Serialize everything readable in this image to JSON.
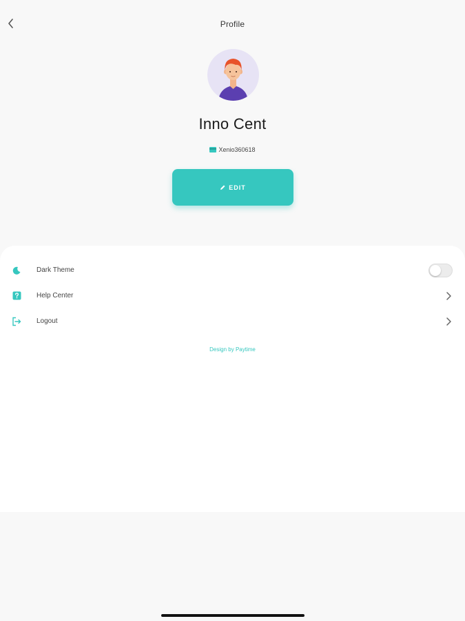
{
  "header": {
    "title": "Profile",
    "back_icon": "chevron-left-icon"
  },
  "profile": {
    "name": "Inno Cent",
    "user_id": "Xenio360618",
    "edit_label": "EDIT",
    "avatar_icon": "user-avatar-icon"
  },
  "settings": {
    "items": [
      {
        "label": "Dark Theme",
        "icon": "moon-icon",
        "control": "toggle",
        "toggle_on": false
      },
      {
        "label": "Help Center",
        "icon": "question-icon",
        "control": "chevron"
      },
      {
        "label": "Logout",
        "icon": "logout-icon",
        "control": "chevron"
      }
    ]
  },
  "footer": {
    "credit": "Design by Paytime"
  },
  "colors": {
    "accent": "#36c7bf",
    "background": "#f8f8f8",
    "panel": "#ffffff"
  }
}
